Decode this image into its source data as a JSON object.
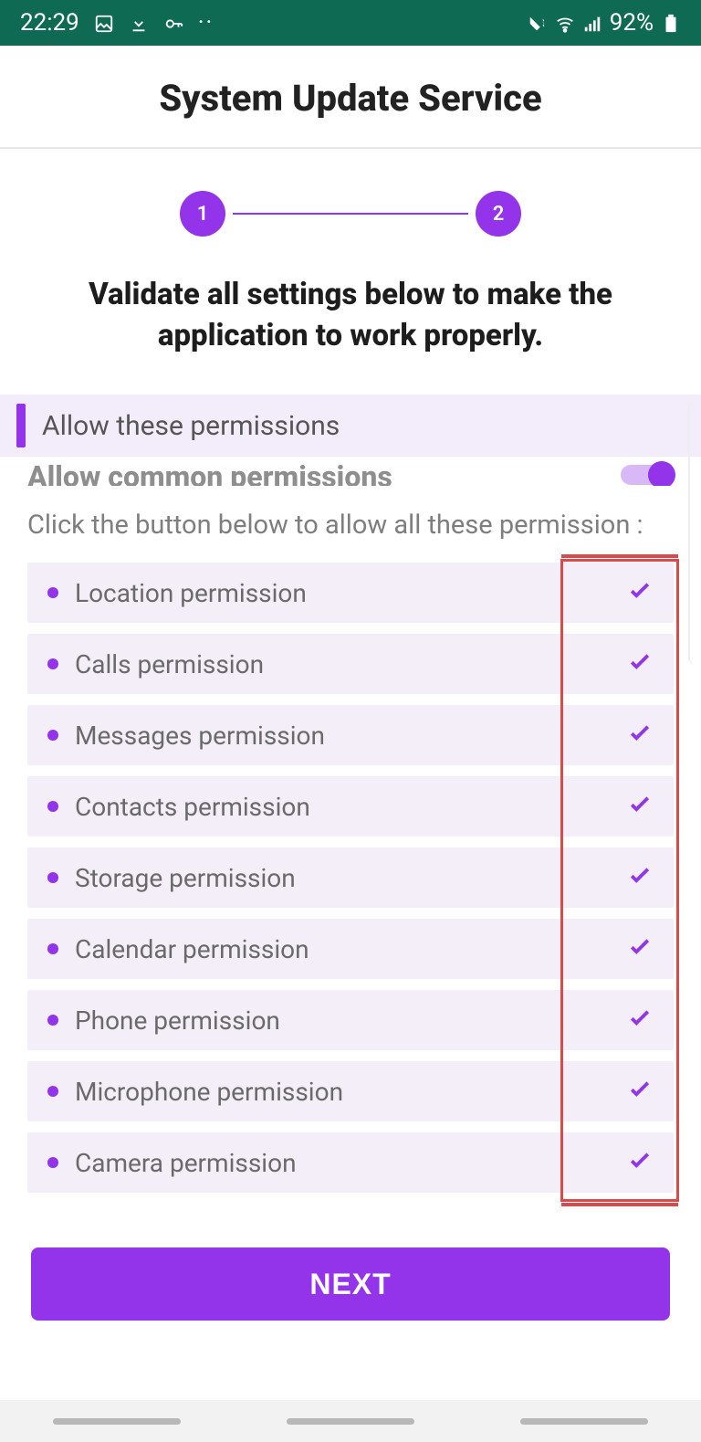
{
  "status": {
    "time": "22:29",
    "battery": "92%"
  },
  "header": {
    "title": "System Update Service"
  },
  "stepper": {
    "step1": "1",
    "step2": "2"
  },
  "subtitle": "Validate all settings below to make the application to work properly.",
  "section": {
    "allow_tab": "Allow these permissions"
  },
  "common": {
    "title": "Allow common permissions",
    "hint": "Click the button below to allow all these permission  :"
  },
  "perms": {
    "items": [
      {
        "label": "Location permission"
      },
      {
        "label": "Calls permission"
      },
      {
        "label": "Messages permission"
      },
      {
        "label": "Contacts permission"
      },
      {
        "label": "Storage permission"
      },
      {
        "label": "Calendar permission"
      },
      {
        "label": "Phone permission"
      },
      {
        "label": "Microphone permission"
      },
      {
        "label": "Camera permission"
      }
    ]
  },
  "next_label": "NEXT"
}
